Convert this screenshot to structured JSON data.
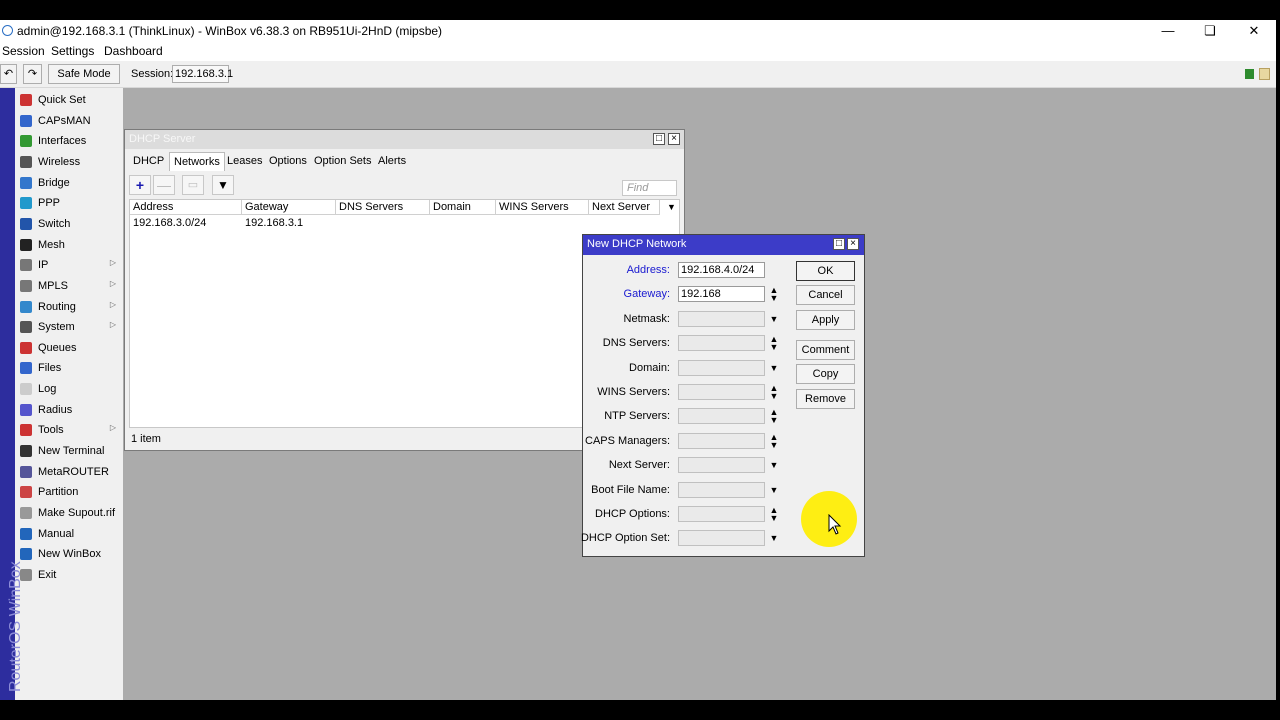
{
  "window": {
    "title": "admin@192.168.3.1 (ThinkLinux) - WinBox v6.38.3 on RB951Ui-2HnD (mipsbe)"
  },
  "menubar": [
    "Session",
    "Settings",
    "Dashboard"
  ],
  "toolbar": {
    "safe_mode": "Safe Mode",
    "session_label": "Session:",
    "session_value": "192.168.3.1"
  },
  "sidebar": {
    "vertical_text": "RouterOS WinBox",
    "items": [
      {
        "label": "Quick Set",
        "icon": "quick-set-icon",
        "color": "#cc3333"
      },
      {
        "label": "CAPsMAN",
        "icon": "capsman-icon",
        "color": "#3366cc"
      },
      {
        "label": "Interfaces",
        "icon": "interfaces-icon",
        "color": "#339933"
      },
      {
        "label": "Wireless",
        "icon": "wireless-icon",
        "color": "#555555"
      },
      {
        "label": "Bridge",
        "icon": "bridge-icon",
        "color": "#3377cc"
      },
      {
        "label": "PPP",
        "icon": "ppp-icon",
        "color": "#2299cc"
      },
      {
        "label": "Switch",
        "icon": "switch-icon",
        "color": "#2255aa"
      },
      {
        "label": "Mesh",
        "icon": "mesh-icon",
        "color": "#222222"
      },
      {
        "label": "IP",
        "icon": "ip-icon",
        "color": "#777777",
        "submenu": true
      },
      {
        "label": "MPLS",
        "icon": "mpls-icon",
        "color": "#777777",
        "submenu": true
      },
      {
        "label": "Routing",
        "icon": "routing-icon",
        "color": "#3388cc",
        "submenu": true
      },
      {
        "label": "System",
        "icon": "system-icon",
        "color": "#555555",
        "submenu": true
      },
      {
        "label": "Queues",
        "icon": "queues-icon",
        "color": "#cc3333"
      },
      {
        "label": "Files",
        "icon": "files-icon",
        "color": "#3366cc"
      },
      {
        "label": "Log",
        "icon": "log-icon",
        "color": "#cccccc"
      },
      {
        "label": "Radius",
        "icon": "radius-icon",
        "color": "#5555cc"
      },
      {
        "label": "Tools",
        "icon": "tools-icon",
        "color": "#cc3333",
        "submenu": true
      },
      {
        "label": "New Terminal",
        "icon": "terminal-icon",
        "color": "#333333"
      },
      {
        "label": "MetaROUTER",
        "icon": "metarouter-icon",
        "color": "#555599"
      },
      {
        "label": "Partition",
        "icon": "partition-icon",
        "color": "#cc4444"
      },
      {
        "label": "Make Supout.rif",
        "icon": "supout-icon",
        "color": "#999999"
      },
      {
        "label": "Manual",
        "icon": "manual-icon",
        "color": "#2266bb"
      },
      {
        "label": "New WinBox",
        "icon": "winbox-icon",
        "color": "#2266bb"
      },
      {
        "label": "Exit",
        "icon": "exit-icon",
        "color": "#888888"
      }
    ]
  },
  "dhcp_server": {
    "title": "DHCP Server",
    "tabs": [
      "DHCP",
      "Networks",
      "Leases",
      "Options",
      "Option Sets",
      "Alerts"
    ],
    "active_tab": "Networks",
    "find_placeholder": "Find",
    "columns": [
      "Address",
      "Gateway",
      "DNS Servers",
      "Domain",
      "WINS Servers",
      "Next Server"
    ],
    "rows": [
      [
        "192.168.3.0/24",
        "192.168.3.1",
        "",
        "",
        "",
        ""
      ]
    ],
    "status": "1 item"
  },
  "new_network": {
    "title": "New DHCP Network",
    "fields": [
      {
        "label": "Address:",
        "value": "192.168.4.0/24",
        "control": "none",
        "highlight": true
      },
      {
        "label": "Gateway:",
        "value": "192.168",
        "control": "updown",
        "highlight": true
      },
      {
        "label": "Netmask:",
        "value": "",
        "control": "down"
      },
      {
        "label": "DNS Servers:",
        "value": "",
        "control": "updown"
      },
      {
        "label": "Domain:",
        "value": "",
        "control": "down"
      },
      {
        "label": "WINS Servers:",
        "value": "",
        "control": "updown"
      },
      {
        "label": "NTP Servers:",
        "value": "",
        "control": "updown"
      },
      {
        "label": "CAPS Managers:",
        "value": "",
        "control": "updown"
      },
      {
        "label": "Next Server:",
        "value": "",
        "control": "down"
      },
      {
        "label": "Boot File Name:",
        "value": "",
        "control": "down"
      },
      {
        "label": "DHCP Options:",
        "value": "",
        "control": "updown"
      },
      {
        "label": "DHCP Option Set:",
        "value": "",
        "control": "down"
      }
    ],
    "buttons": {
      "ok": "OK",
      "cancel": "Cancel",
      "apply": "Apply",
      "comment": "Comment",
      "copy": "Copy",
      "remove": "Remove"
    }
  },
  "colors": {
    "desktop": "#ababab",
    "sidebar_strip": "#2d2d9e",
    "active_title": "#3c3cc8",
    "inactive_title": "#dcdcdc",
    "label_blue": "#1a1ad0",
    "cursor_highlight": "#ffee00"
  }
}
